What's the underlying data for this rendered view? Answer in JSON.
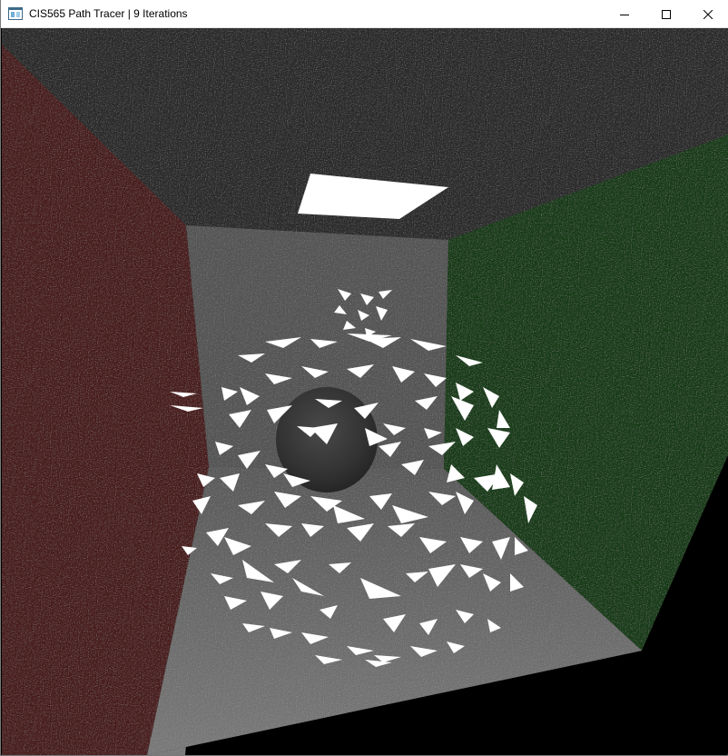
{
  "window": {
    "title": "CIS565 Path Tracer | 9 Iterations",
    "icons": {
      "app": "app-window-icon",
      "minimize": "minimize-icon",
      "maximize": "maximize-icon",
      "close": "close-icon"
    }
  },
  "scene": {
    "description_colors": {
      "background": "#000000",
      "ceiling": "#2c2c2c",
      "back_wall": "#545454",
      "floor": "#6a6a6a",
      "left_wall": "#4a1c1c",
      "right_wall": "#173d17",
      "light": "#ffffff",
      "sphere": "#3a3a3a",
      "mesh_triangles": "#ffffff"
    }
  }
}
